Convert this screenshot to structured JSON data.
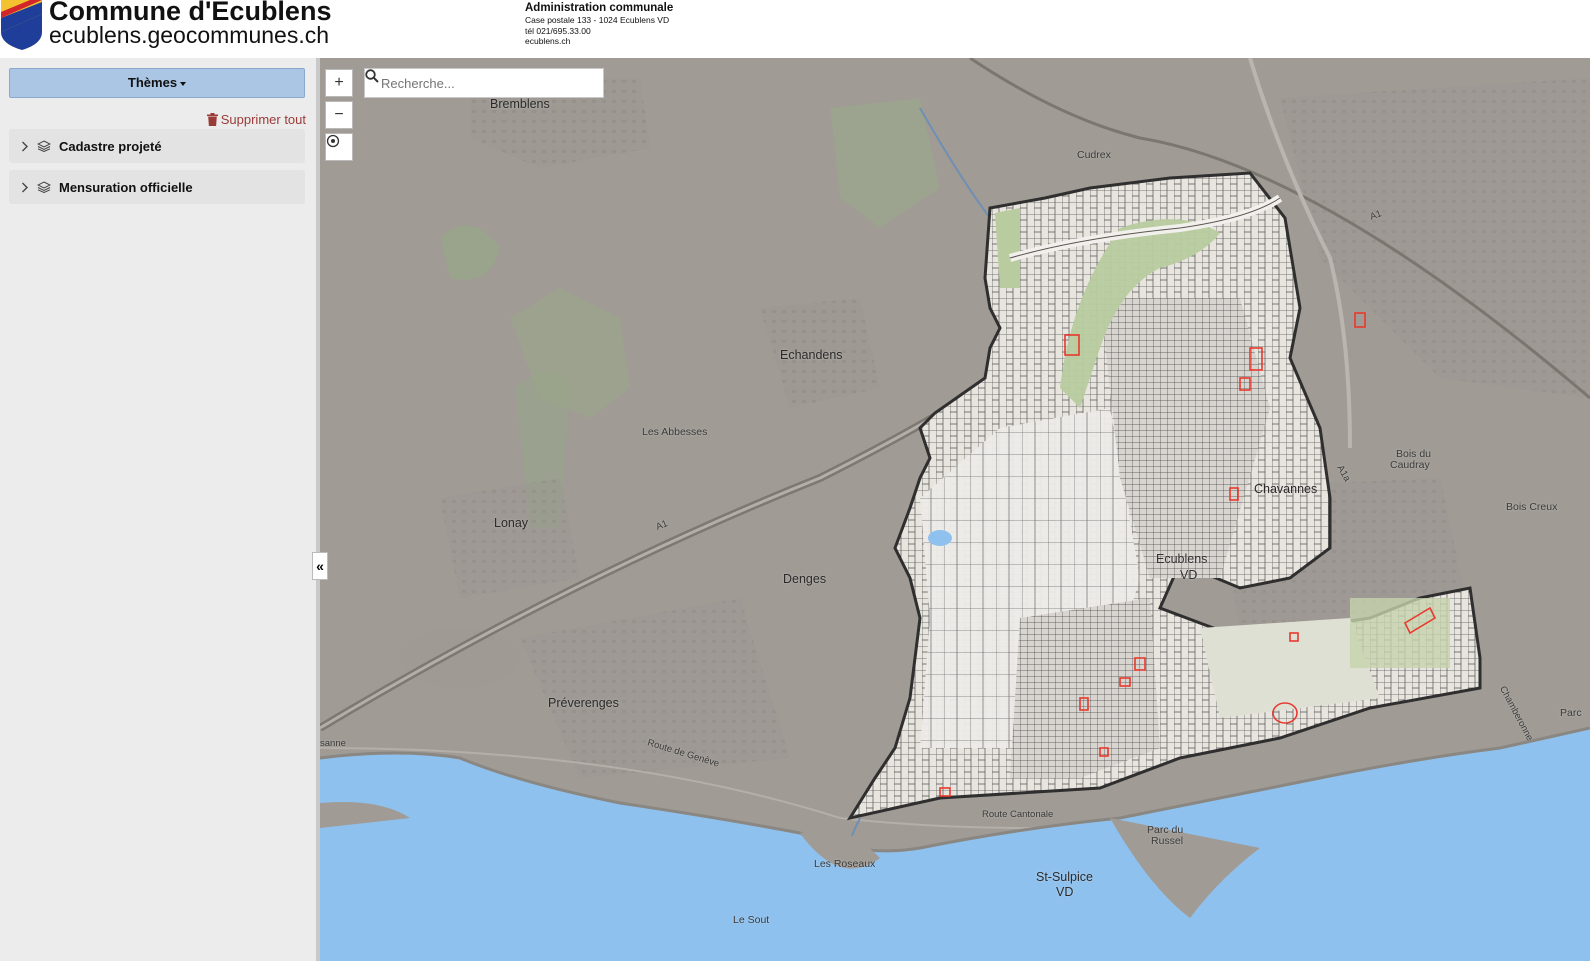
{
  "header": {
    "title": "Commune d'Ecublens",
    "url": "ecublens.geocommunes.ch",
    "admin": {
      "title": "Administration communale",
      "line1": "Case postale 133 - 1024 Ecublens VD",
      "line2": "tél 021/695.33.00",
      "line3": "ecublens.ch"
    }
  },
  "sidebar": {
    "themes_label": "Thèmes",
    "delete_all_label": "Supprimer tout",
    "layers": [
      {
        "label": "Cadastre projeté"
      },
      {
        "label": "Mensuration officielle"
      }
    ],
    "collapse_label": "«"
  },
  "map": {
    "zoom_in": "+",
    "zoom_out": "−",
    "search_placeholder": "Recherche...",
    "places": {
      "bremblens": "Bremblens",
      "echandens": "Echandens",
      "les_abbesses": "Les Abbesses",
      "lonay": "Lonay",
      "denges": "Denges",
      "preverenges": "Préverenges",
      "cudrex": "Cudrex",
      "chavannes": "Chavannes",
      "bois_du_caudray_1": "Bois du",
      "bois_du_caudray_2": "Caudray",
      "bois_creux": "Bois Creux",
      "ecublens_1": "Ecublens",
      "ecublens_2": "VD",
      "parc_du_russel_1": "Parc du",
      "parc_du_russel_2": "Russel",
      "st_sulpice_1": "St-Sulpice",
      "st_sulpice_2": "VD",
      "les_roseaux": "Les Roseaux",
      "le_sout": "Le Sout",
      "route_de_geneve": "Route de Genève",
      "route_cantonale": "Route Cantonale",
      "a1_west": "A1",
      "a1_north": "A1",
      "a1a": "A1a",
      "sanne": "sanne",
      "parc": "Parc",
      "chamberonne": "Chamberonne"
    }
  },
  "colors": {
    "themes_button": "#aac6e4",
    "delete_link": "#9a3b37",
    "lake": "#8fc1ee",
    "map_base": "#a19c96",
    "parcel_highlight": "#e8392e"
  }
}
